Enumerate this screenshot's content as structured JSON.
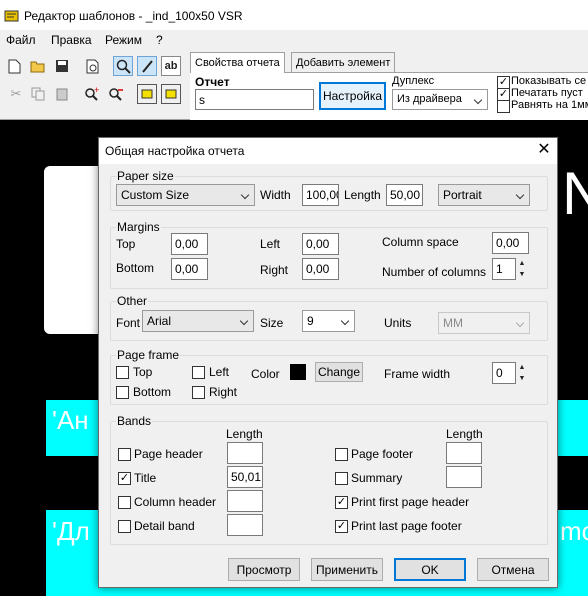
{
  "window": {
    "title": "Редактор шаблонов - _ind_100x50 VSR"
  },
  "menu": [
    "Файл",
    "Правка",
    "Режим",
    "?"
  ],
  "tabs": [
    "Свойства отчета",
    "Добавить элемент"
  ],
  "props": {
    "report_label": "Отчет",
    "report_value": "s",
    "setup_button": "Настройка",
    "duplex_label": "Дуплекс",
    "duplex_value": "Из драйвера",
    "checks": [
      {
        "label": "Показывать се",
        "checked": true
      },
      {
        "label": "Печатать пуст",
        "checked": true
      },
      {
        "label": "Равнять на 1мм",
        "checked": false
      }
    ]
  },
  "background": {
    "letter_right": "N",
    "cyan_text_1": "'Ан",
    "cyan_text_2": "'Дл",
    "cyan_text_3": "mo"
  },
  "dialog": {
    "title": "Общая настройка отчета",
    "paper": {
      "legend": "Paper size",
      "size_value": "Custom Size",
      "width_label": "Width",
      "width_value": "100,00",
      "length_label": "Length",
      "length_value": "50,00",
      "orientation": "Portrait"
    },
    "margins": {
      "legend": "Margins",
      "top_label": "Top",
      "top_value": "0,00",
      "bottom_label": "Bottom",
      "bottom_value": "0,00",
      "left_label": "Left",
      "left_value": "0,00",
      "right_label": "Right",
      "right_value": "0,00",
      "colspace_label": "Column space",
      "colspace_value": "0,00",
      "columns_label": "Number of columns",
      "columns_value": "1"
    },
    "other": {
      "legend": "Other",
      "font_label": "Font",
      "font_value": "Arial",
      "size_label": "Size",
      "size_value": "9",
      "units_label": "Units",
      "units_value": "MM"
    },
    "frame": {
      "legend": "Page frame",
      "top": "Top",
      "bottom": "Bottom",
      "left": "Left",
      "right": "Right",
      "color_label": "Color",
      "color": "#000000",
      "change_button": "Change",
      "width_label": "Frame width",
      "width_value": "0"
    },
    "bands": {
      "legend": "Bands",
      "length_header": "Length",
      "left": [
        {
          "label": "Page header",
          "checked": false,
          "length": ""
        },
        {
          "label": "Title",
          "checked": true,
          "length": "50,01"
        },
        {
          "label": "Column header",
          "checked": false,
          "length": ""
        },
        {
          "label": "Detail band",
          "checked": false,
          "length": ""
        }
      ],
      "right": [
        {
          "label": "Page footer",
          "checked": false,
          "length": ""
        },
        {
          "label": "Summary",
          "checked": false,
          "length": ""
        },
        {
          "label": "Print first page header",
          "checked": true
        },
        {
          "label": "Print last page footer",
          "checked": true
        }
      ]
    },
    "buttons": {
      "preview": "Просмотр",
      "apply": "Применить",
      "ok": "OK",
      "cancel": "Отмена"
    }
  },
  "colors": {
    "accent": "#0078d7",
    "cyan": "#00ffff"
  }
}
